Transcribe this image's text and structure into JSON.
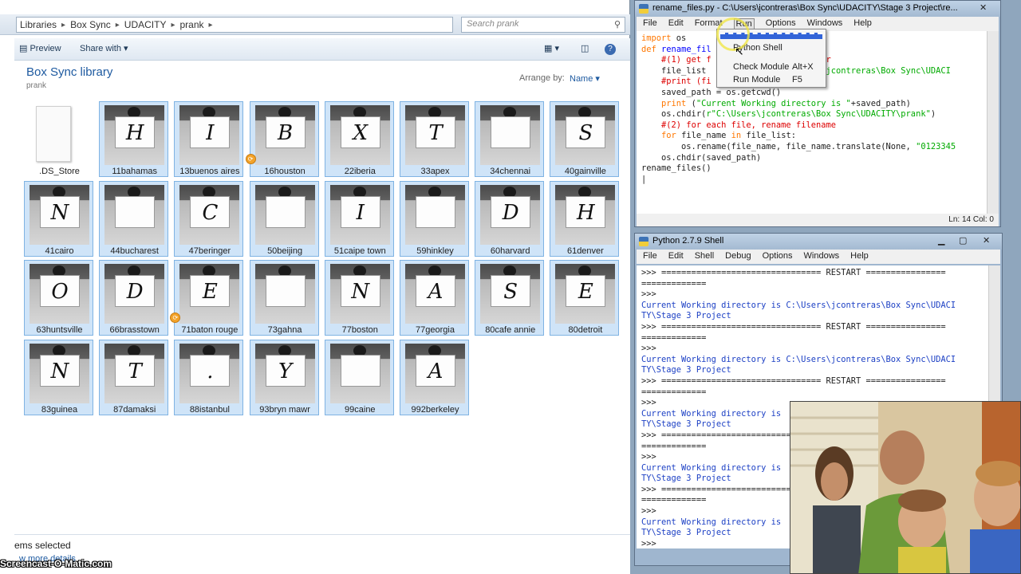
{
  "explorer": {
    "breadcrumb": [
      "Libraries",
      "Box Sync",
      "UDACITY",
      "prank"
    ],
    "search_placeholder": "Search prank",
    "toolbar": {
      "preview": "Preview",
      "share_with": "Share with"
    },
    "library_title": "Box Sync library",
    "library_subtitle": "prank",
    "arrange_by_label": "Arrange by:",
    "arrange_by_value": "Name",
    "files": [
      {
        "name": ".DS_Store",
        "letter": "",
        "type": "doc"
      },
      {
        "name": "11bahamas",
        "letter": "H"
      },
      {
        "name": "13buenos aires",
        "letter": "I"
      },
      {
        "name": "16houston",
        "letter": "B"
      },
      {
        "name": "22iberia",
        "letter": "X"
      },
      {
        "name": "33apex",
        "letter": "T"
      },
      {
        "name": "34chennai",
        "letter": ""
      },
      {
        "name": "40gainville",
        "letter": "S"
      },
      {
        "name": "41cairo",
        "letter": "N"
      },
      {
        "name": "44bucharest",
        "letter": ""
      },
      {
        "name": "47beringer",
        "letter": "C"
      },
      {
        "name": "50beijing",
        "letter": ""
      },
      {
        "name": "51caipe town",
        "letter": "I"
      },
      {
        "name": "59hinkley",
        "letter": ""
      },
      {
        "name": "60harvard",
        "letter": "D"
      },
      {
        "name": "61denver",
        "letter": "H"
      },
      {
        "name": "63huntsville",
        "letter": "O"
      },
      {
        "name": "66brasstown",
        "letter": "D"
      },
      {
        "name": "71baton rouge",
        "letter": "E"
      },
      {
        "name": "73gahna",
        "letter": ""
      },
      {
        "name": "77boston",
        "letter": "N"
      },
      {
        "name": "77georgia",
        "letter": "A"
      },
      {
        "name": "80cafe annie",
        "letter": "S"
      },
      {
        "name": "80detroit",
        "letter": "E"
      },
      {
        "name": "83guinea",
        "letter": "N"
      },
      {
        "name": "87damaksi",
        "letter": "T"
      },
      {
        "name": "88istanbul",
        "letter": "."
      },
      {
        "name": "93bryn mawr",
        "letter": "Y"
      },
      {
        "name": "99caine",
        "letter": ""
      },
      {
        "name": "992berkeley",
        "letter": "A"
      }
    ],
    "status_text": "ems selected",
    "status_more": "w more details"
  },
  "watermark": "Screencast-O-Matic.com",
  "editor": {
    "title": "rename_files.py - C:\\Users\\jcontreras\\Box Sync\\UDACITY\\Stage 3 Project\\re...",
    "menu": [
      "File",
      "Edit",
      "Format",
      "Run",
      "Options",
      "Windows",
      "Help"
    ],
    "status": "Ln: 14  Col: 0",
    "run_menu": {
      "items": [
        {
          "label": "Python Shell",
          "key": ""
        },
        {
          "label": "Check Module",
          "key": "Alt+X"
        },
        {
          "label": "Run Module",
          "key": "F5"
        }
      ]
    }
  },
  "shell": {
    "title": "Python 2.7.9 Shell",
    "menu": [
      "File",
      "Edit",
      "Shell",
      "Debug",
      "Options",
      "Windows",
      "Help"
    ],
    "lines": [
      ">>> ================================ RESTART ================",
      "=============",
      ">>>",
      "Current Working directory is C:\\Users\\jcontreras\\Box Sync\\UDACI",
      "TY\\Stage 3 Project",
      ">>> ================================ RESTART ================",
      "=============",
      ">>>",
      "Current Working directory is C:\\Users\\jcontreras\\Box Sync\\UDACI",
      "TY\\Stage 3 Project",
      ">>> ================================ RESTART ================",
      "=============",
      ">>>",
      "Current Working directory is",
      "TY\\Stage 3 Project",
      ">>> ================================",
      "=============",
      ">>>",
      "Current Working directory is",
      "TY\\Stage 3 Project",
      ">>> ================================",
      "=============",
      ">>>",
      "Current Working directory is",
      "TY\\Stage 3 Project",
      ">>>"
    ]
  }
}
